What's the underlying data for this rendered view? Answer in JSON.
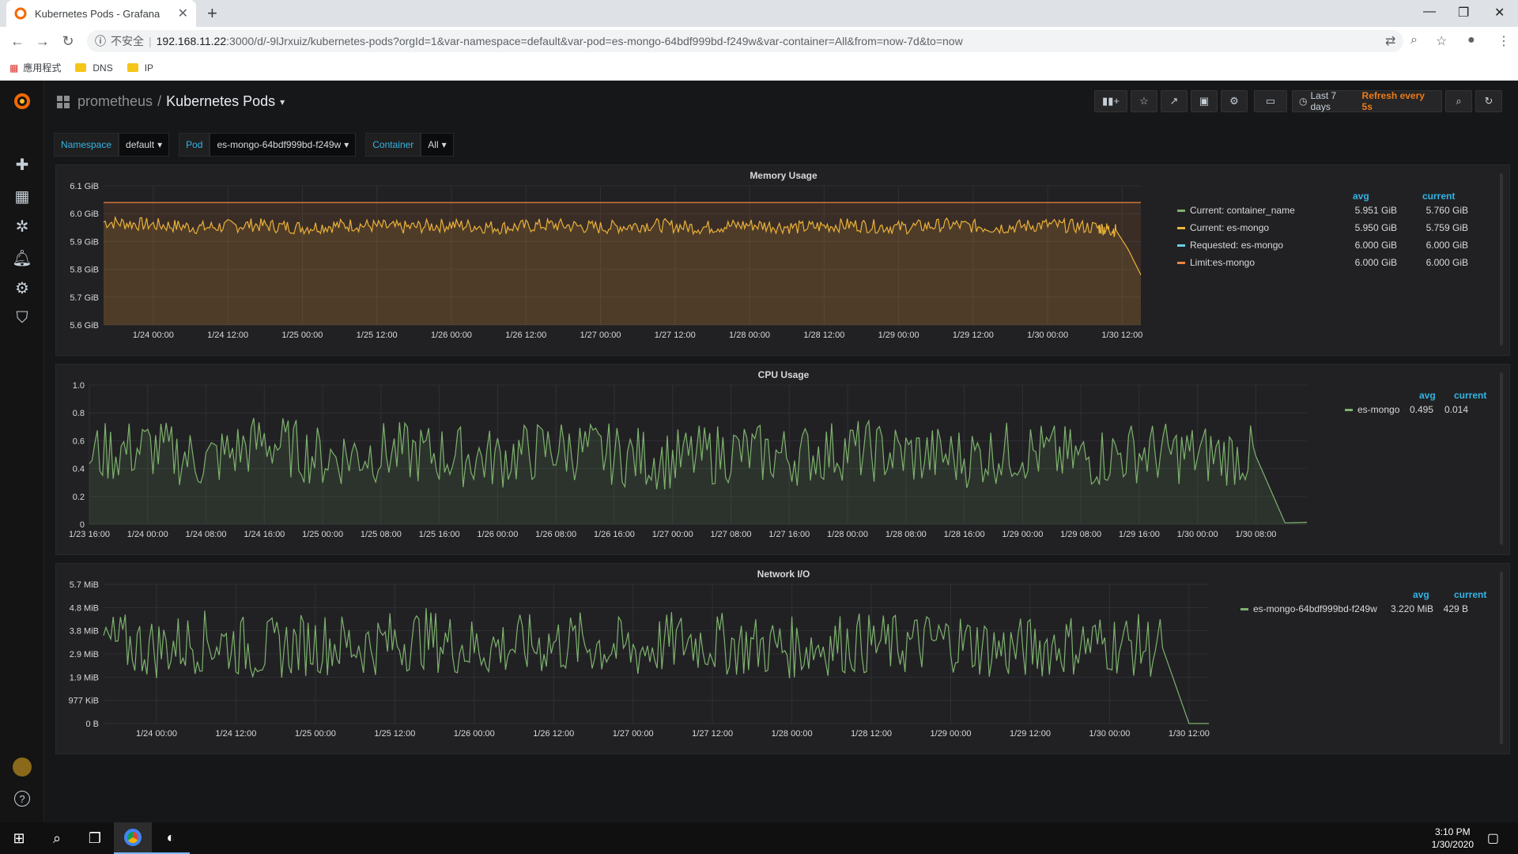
{
  "browser": {
    "tab_title": "Kubernetes Pods - Grafana",
    "security_label": "不安全",
    "url_host": "192.168.11.22",
    "url_rest": ":3000/d/-9lJrxuiz/kubernetes-pods?orgId=1&var-namespace=default&var-pod=es-mongo-64bdf999bd-f249w&var-container=All&from=now-7d&to=now",
    "bookmarks": [
      "應用程式",
      "DNS",
      "IP"
    ]
  },
  "dashboard": {
    "folder": "prometheus",
    "separator": "/",
    "title": "Kubernetes Pods",
    "time_range": "Last 7 days",
    "refresh": "Refresh every 5s"
  },
  "variables": [
    {
      "label": "Namespace",
      "value": "default"
    },
    {
      "label": "Pod",
      "value": "es-mongo-64bdf999bd-f249w"
    },
    {
      "label": "Container",
      "value": "All"
    }
  ],
  "panels": {
    "memory": {
      "title": "Memory Usage",
      "legend_headers": [
        "avg",
        "current"
      ],
      "legend": [
        {
          "name": "Current: container_name",
          "avg": "5.951 GiB",
          "current": "5.760 GiB",
          "color": "#7eb26d"
        },
        {
          "name": "Current: es-mongo",
          "avg": "5.950 GiB",
          "current": "5.759 GiB",
          "color": "#eab839"
        },
        {
          "name": "Requested: es-mongo",
          "avg": "6.000 GiB",
          "current": "6.000 GiB",
          "color": "#6ed0e0"
        },
        {
          "name": "Limit:es-mongo",
          "avg": "6.000 GiB",
          "current": "6.000 GiB",
          "color": "#ef843c"
        }
      ]
    },
    "cpu": {
      "title": "CPU Usage",
      "legend_headers": [
        "avg",
        "current"
      ],
      "legend": [
        {
          "name": "es-mongo",
          "avg": "0.495",
          "current": "0.014",
          "color": "#7eb26d"
        }
      ]
    },
    "network": {
      "title": "Network I/O",
      "legend_headers": [
        "avg",
        "current"
      ],
      "legend": [
        {
          "name": "es-mongo-64bdf999bd-f249w",
          "avg": "3.220 MiB",
          "current": "429 B",
          "color": "#7eb26d"
        }
      ]
    }
  },
  "taskbar": {
    "time": "3:10 PM",
    "date": "1/30/2020"
  },
  "chart_data": [
    {
      "type": "line",
      "title": "Memory Usage",
      "y_tick_labels": [
        "5.6 GiB",
        "5.7 GiB",
        "5.8 GiB",
        "5.9 GiB",
        "6.0 GiB",
        "6.1 GiB"
      ],
      "ylim": [
        5.6,
        6.1
      ],
      "x_tick_labels": [
        "1/24 00:00",
        "1/24 12:00",
        "1/25 00:00",
        "1/25 12:00",
        "1/26 00:00",
        "1/26 12:00",
        "1/27 00:00",
        "1/27 12:00",
        "1/28 00:00",
        "1/28 12:00",
        "1/29 00:00",
        "1/29 12:00",
        "1/30 00:00",
        "1/30 12:00"
      ],
      "x": [
        "1/23 16:00",
        "1/24 00:00",
        "1/24 08:00",
        "1/24 16:00",
        "1/25 00:00",
        "1/25 08:00",
        "1/25 16:00",
        "1/26 00:00",
        "1/26 08:00",
        "1/26 16:00",
        "1/27 00:00",
        "1/27 08:00",
        "1/27 16:00",
        "1/28 00:00",
        "1/28 08:00",
        "1/28 16:00",
        "1/29 00:00",
        "1/29 08:00",
        "1/29 16:00",
        "1/30 00:00",
        "1/30 08:00",
        "1/30 11:00",
        "1/30 13:00",
        "1/30 15:00"
      ],
      "series": [
        {
          "name": "Current: es-mongo",
          "color": "#eab839",
          "values": [
            5.97,
            5.96,
            5.95,
            5.96,
            5.95,
            5.96,
            5.95,
            5.96,
            5.95,
            5.96,
            5.95,
            5.96,
            5.95,
            5.96,
            5.95,
            5.96,
            5.95,
            5.96,
            5.95,
            5.96,
            5.95,
            5.94,
            5.87,
            5.78
          ]
        },
        {
          "name": "Limit:es-mongo",
          "color": "#ef843c",
          "values": [
            6.04,
            6.04,
            6.04,
            6.04,
            6.04,
            6.04,
            6.04,
            6.04,
            6.04,
            6.04,
            6.04,
            6.04,
            6.04,
            6.04,
            6.04,
            6.04,
            6.04,
            6.04,
            6.04,
            6.04,
            6.04,
            6.04,
            6.04,
            6.04
          ]
        }
      ]
    },
    {
      "type": "line",
      "title": "CPU Usage",
      "y_tick_labels": [
        "0",
        "0.2",
        "0.4",
        "0.6",
        "0.8",
        "1.0"
      ],
      "ylim": [
        0,
        1.0
      ],
      "x_tick_labels": [
        "1/23 16:00",
        "1/24 00:00",
        "1/24 08:00",
        "1/24 16:00",
        "1/25 00:00",
        "1/25 08:00",
        "1/25 16:00",
        "1/26 00:00",
        "1/26 08:00",
        "1/26 16:00",
        "1/27 00:00",
        "1/27 08:00",
        "1/27 16:00",
        "1/28 00:00",
        "1/28 08:00",
        "1/28 16:00",
        "1/29 00:00",
        "1/29 08:00",
        "1/29 16:00",
        "1/30 00:00",
        "1/30 08:00"
      ],
      "x": [
        "1/23 16:00",
        "1/24 00:00",
        "1/24 08:00",
        "1/24 16:00",
        "1/25 00:00",
        "1/25 08:00",
        "1/25 16:00",
        "1/26 00:00",
        "1/26 08:00",
        "1/26 16:00",
        "1/27 00:00",
        "1/27 08:00",
        "1/27 16:00",
        "1/28 00:00",
        "1/28 08:00",
        "1/28 16:00",
        "1/29 00:00",
        "1/29 08:00",
        "1/29 16:00",
        "1/30 00:00",
        "1/30 08:00",
        "1/30 12:00",
        "1/30 15:00"
      ],
      "series": [
        {
          "name": "es-mongo",
          "color": "#7eb26d",
          "values": [
            0.5,
            0.55,
            0.45,
            0.6,
            0.48,
            0.52,
            0.5,
            0.47,
            0.55,
            0.5,
            0.46,
            0.52,
            0.49,
            0.54,
            0.5,
            0.48,
            0.53,
            0.47,
            0.52,
            0.5,
            0.49,
            0.01,
            0.014
          ]
        }
      ]
    },
    {
      "type": "line",
      "title": "Network I/O",
      "y_tick_labels": [
        "0 B",
        "977 KiB",
        "1.9 MiB",
        "2.9 MiB",
        "3.8 MiB",
        "4.8 MiB",
        "5.7 MiB"
      ],
      "ylim": [
        0,
        5.7
      ],
      "y_unit": "MiB",
      "x_tick_labels": [
        "1/24 00:00",
        "1/24 12:00",
        "1/25 00:00",
        "1/25 12:00",
        "1/26 00:00",
        "1/26 12:00",
        "1/27 00:00",
        "1/27 12:00",
        "1/28 00:00",
        "1/28 12:00",
        "1/29 00:00",
        "1/29 12:00",
        "1/30 00:00",
        "1/30 12:00"
      ],
      "x": [
        "1/23 16:00",
        "1/24 00:00",
        "1/24 08:00",
        "1/24 16:00",
        "1/25 00:00",
        "1/25 08:00",
        "1/25 16:00",
        "1/26 00:00",
        "1/26 08:00",
        "1/26 16:00",
        "1/27 00:00",
        "1/27 08:00",
        "1/27 16:00",
        "1/28 00:00",
        "1/28 08:00",
        "1/28 16:00",
        "1/29 00:00",
        "1/29 08:00",
        "1/29 16:00",
        "1/30 00:00",
        "1/30 08:00",
        "1/30 12:00",
        "1/30 15:00"
      ],
      "series": [
        {
          "name": "es-mongo-64bdf999bd-f249w",
          "color": "#7eb26d",
          "values": [
            3.3,
            3.1,
            3.4,
            3.0,
            3.3,
            3.2,
            3.5,
            3.1,
            3.2,
            3.3,
            3.0,
            3.4,
            3.2,
            3.1,
            3.3,
            3.2,
            3.4,
            3.0,
            3.2,
            3.3,
            3.1,
            0.0004,
            0.0004
          ]
        }
      ]
    }
  ]
}
